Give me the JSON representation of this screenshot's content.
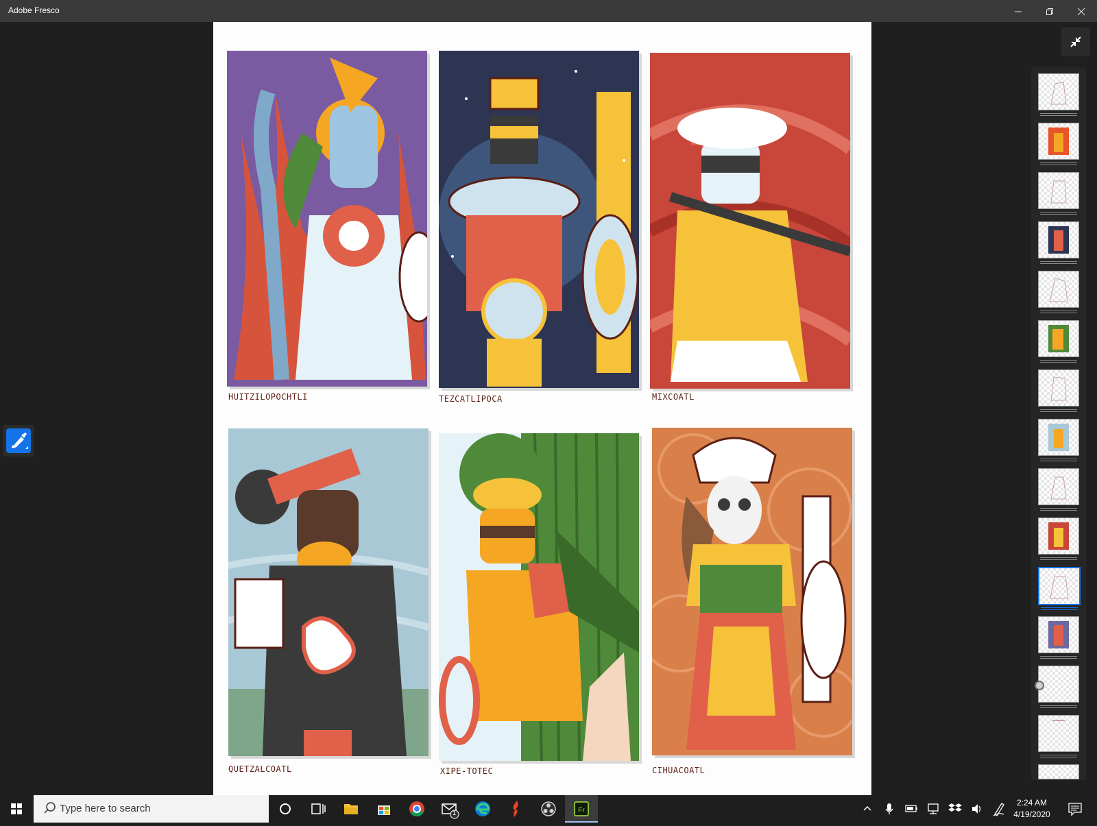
{
  "window": {
    "title": "Adobe Fresco"
  },
  "artwork": {
    "panels": [
      {
        "caption": "HUITZILOPOCHTLI",
        "bg": "#7a5aa0"
      },
      {
        "caption": "TEZCATLIPOCA",
        "bg": "#2e3552"
      },
      {
        "caption": "MIXCOATL",
        "bg": "#c8463a"
      },
      {
        "caption": "QUETZALCOATL",
        "bg": "#a9c8d6"
      },
      {
        "caption": "XIPE-TOTEC",
        "bg": "#4f8a3a"
      },
      {
        "caption": "CIHUACOATL",
        "bg": "#d9804a"
      }
    ]
  },
  "layers": {
    "count": 15,
    "selected_index": 10
  },
  "taskbar": {
    "search_placeholder": "Type here to search",
    "mail_badge": "1",
    "time": "2:24 AM",
    "date": "4/19/2020"
  },
  "colors": {
    "accent": "#1473e6",
    "titlebar": "#3a3a3a",
    "workspace": "#1f1f1f"
  },
  "icons": {
    "minimize": "minimize-icon",
    "restore": "restore-icon",
    "close": "close-icon",
    "collapse": "collapse-arrows-icon",
    "brush": "pixel-brush-icon"
  }
}
